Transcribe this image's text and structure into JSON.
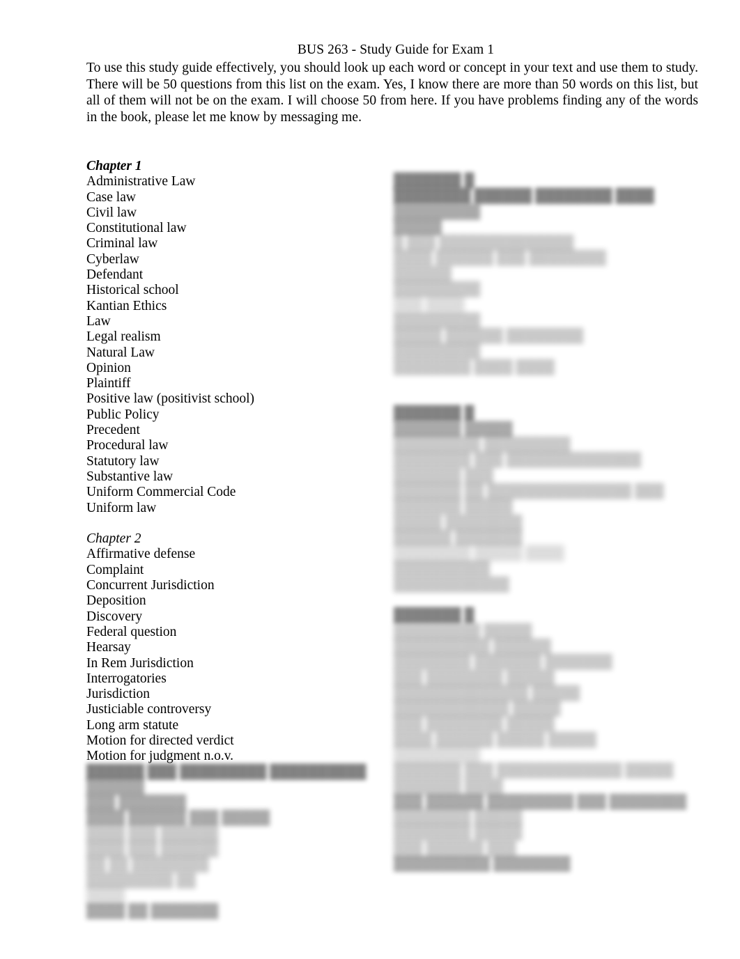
{
  "document": {
    "title": "BUS 263 - Study Guide for Exam 1",
    "intro": "To use this study guide effectively, you should look up each word or concept in your text and use them to study.   There will be 50 questions from this list on the exam.  Yes, I know there are more than 50 words on this list, but all of them will not be on the exam. I will choose 50 from here.  If you have problems finding any of the words in the book, please let me know by messaging me."
  },
  "left_column": {
    "chapter1": {
      "heading": "Chapter 1",
      "terms": [
        "Administrative Law",
        "Case law",
        "Civil law",
        "Constitutional law",
        "Criminal law",
        "Cyberlaw",
        "Defendant",
        "Historical school",
        "Kantian Ethics",
        "Law",
        "Legal realism",
        "Natural Law",
        "Opinion",
        "Plaintiff",
        "Positive law (positivist school)",
        "Public Policy",
        "Precedent",
        "Procedural law",
        "Statutory law",
        "Substantive law",
        "Uniform Commercial Code",
        "Uniform law"
      ]
    },
    "chapter2": {
      "heading": "Chapter 2",
      "terms": [
        "Affirmative defense",
        "Complaint",
        "Concurrent Jurisdiction",
        "Deposition",
        "Discovery",
        "Federal question",
        "Hearsay",
        "In Rem Jurisdiction",
        "Interrogatories",
        "Jurisdiction",
        "Justiciable controversy",
        "Long arm statute",
        "Motion for directed verdict",
        "Motion for judgment n.o.v."
      ]
    },
    "obscured_block": {
      "note": "illegible blurred text",
      "lines": [
        "██████ ███ █████████ ██████████",
        "██████",
        "███ ███████",
        "████ ██████ ███ █████",
        "████ ███ ██████",
        "████ ███ ██████",
        "██ ██ ████████",
        "█████████ ██",
        "████",
        "████ ██ ███████"
      ]
    }
  },
  "right_column": {
    "group1": {
      "heading": "███████ █",
      "lines": [
        "████████ ██████ ████████ ████",
        "█████████",
        "█████",
        "█ ███ ██████████████",
        "████ ██████ ███ ████████",
        "██████",
        "█████████",
        "███ ████",
        "█████████",
        "█████ ██████ ████████",
        "█████████",
        "████████ ████ ████"
      ]
    },
    "group2": {
      "heading": "███████ █",
      "lines": [
        "███████ █████",
        "█████████ █████████",
        "████████ ███ ██████████████",
        "███████ ███",
        "███████ ██ ███████████████ ███",
        "███████ █████",
        "█████ ████████",
        "██████ ███████",
        "████████ █████ ████",
        "██████████",
        "████████████"
      ]
    },
    "group3": {
      "heading": "███████ █",
      "lines": [
        "█████████ █████",
        "██████████ ██████",
        "████████ ███████ ███████",
        "███ ████████ █████",
        "██████████████ █████",
        "████████████ █████",
        "███ ████████ █████",
        "████ ██████ █████ █████",
        "█████████",
        "███████ ███ █████████████ █████",
        "███████ ████",
        "███ ██████ █████████ ███ ████████",
        "████████ █████",
        "████████ █████",
        "███ ██████ ███",
        "██████████ ████████"
      ]
    }
  }
}
